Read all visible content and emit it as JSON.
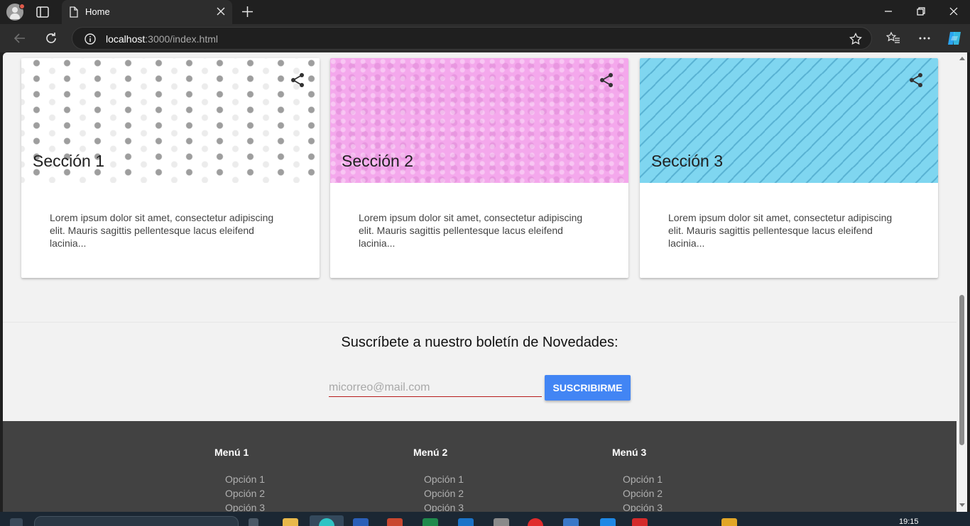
{
  "browser": {
    "tab_title": "Home",
    "url_host": "localhost",
    "url_rest": ":3000/index.html"
  },
  "sections": [
    {
      "title": "Sección 1",
      "text": "Lorem ipsum dolor sit amet, consectetur adipiscing elit. Mauris sagittis pellentesque lacus eleifend lacinia...",
      "color": "#ffffff"
    },
    {
      "title": "Sección 2",
      "text": "Lorem ipsum dolor sit amet, consectetur adipiscing elit. Mauris sagittis pellentesque lacus eleifend lacinia...",
      "color": "#f4a8ec"
    },
    {
      "title": "Sección 3",
      "text": "Lorem ipsum dolor sit amet, consectetur adipiscing elit. Mauris sagittis pellentesque lacus eleifend lacinia...",
      "color": "#7fd6f0"
    }
  ],
  "newsletter": {
    "title": "Suscríbete a nuestro boletín de Novedades:",
    "placeholder": "micorreo@mail.com",
    "button_label": "SUSCRIBIRME",
    "button_color": "#4285f4"
  },
  "footer": {
    "menus": [
      {
        "title": "Menú 1",
        "items": [
          "Opción 1",
          "Opción 2",
          "Opción 3"
        ]
      },
      {
        "title": "Menú 2",
        "items": [
          "Opción 1",
          "Opción 2",
          "Opción 3"
        ]
      },
      {
        "title": "Menú 3",
        "items": [
          "Opción 1",
          "Opción 2",
          "Opción 3"
        ]
      }
    ],
    "background": "#424242"
  },
  "taskbar": {
    "clock": "19:15"
  }
}
